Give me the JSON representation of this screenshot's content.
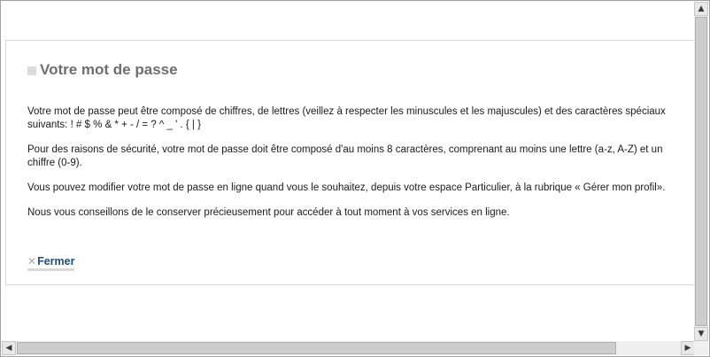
{
  "panel": {
    "title": "Votre mot de passe",
    "paragraphs": [
      "Votre mot de passe peut être composé de chiffres, de lettres (veillez à respecter les minuscules et les majuscules) et des caractères spéciaux suivants: ! # $ % & * + - / = ? ^ _ ' . { | }",
      "Pour des raisons de sécurité, votre mot de passe doit être composé d'au moins 8 caractères, comprenant au moins une lettre (a-z, A-Z) et un chiffre (0-9).",
      "Vous pouvez modifier votre mot de passe en ligne quand vous le souhaitez, depuis votre espace Particulier, à la rubrique « Gérer mon profil».",
      "Nous vous conseillons de le conserver précieusement pour accéder à tout moment à vos services en ligne."
    ],
    "close_label": "Fermer"
  },
  "scrollbars": {
    "up_glyph": "▲",
    "down_glyph": "▼",
    "left_glyph": "◀",
    "right_glyph": "▶"
  },
  "colors": {
    "title": "#6e6e6e",
    "link": "#1f4f7a",
    "text": "#1a1a1a"
  }
}
